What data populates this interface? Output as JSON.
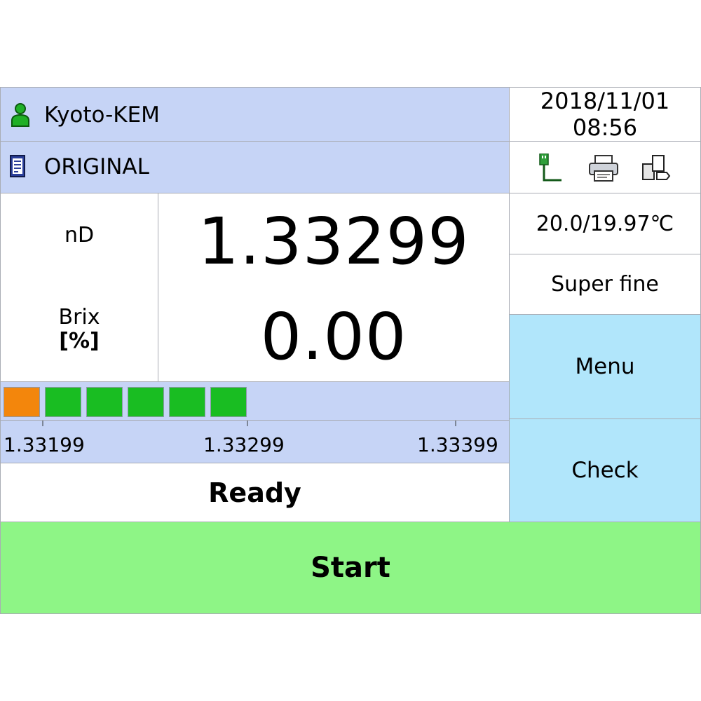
{
  "header": {
    "user_name": "Kyoto-KEM",
    "user_icon": "user-icon",
    "method_name": "ORIGINAL",
    "method_icon": "document-icon"
  },
  "clock": {
    "date": "2018/11/01",
    "time": "08:56"
  },
  "status_icons": [
    "usb-icon",
    "printer-icon",
    "data-transfer-icon"
  ],
  "readings": {
    "primary_unit": "nD",
    "primary_value": "1.33299",
    "secondary_unit_line1": "Brix",
    "secondary_unit_line2": "[%]",
    "secondary_value": "0.00"
  },
  "temperature": "20.0/19.97℃",
  "precision_mode": "Super fine",
  "stability_bar": {
    "segments_filled": 6,
    "colors": {
      "first": "#f3860c",
      "rest": "#19bd22"
    }
  },
  "scale": {
    "left": "1.33199",
    "center": "1.33299",
    "right": "1.33399"
  },
  "status": "Ready",
  "buttons": {
    "menu": "Menu",
    "check": "Check",
    "start": "Start"
  },
  "colors": {
    "header_bg": "#c6d4f6",
    "button_bg": "#b1e6fb",
    "start_bg": "#8ef586"
  }
}
